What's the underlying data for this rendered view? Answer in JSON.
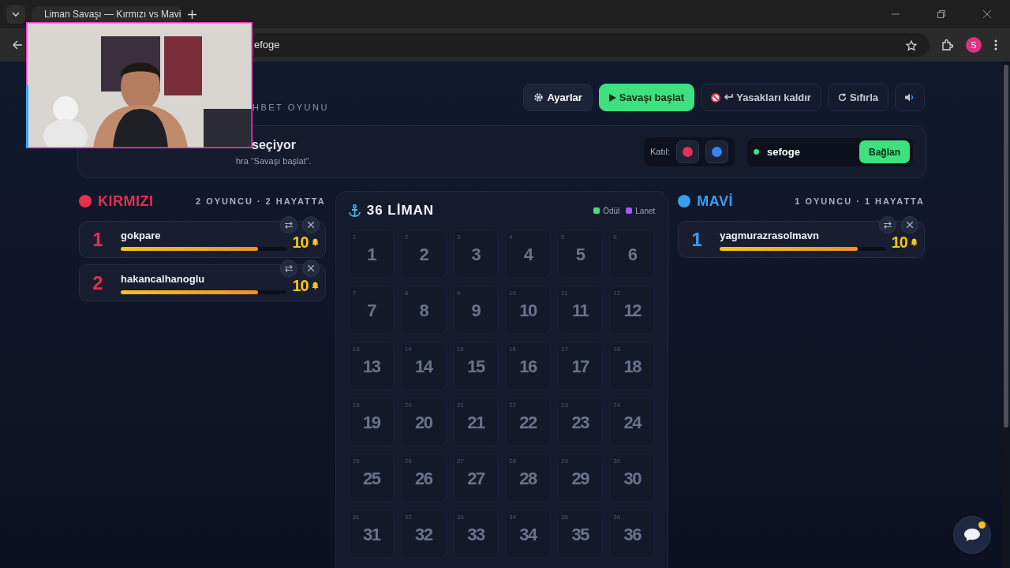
{
  "browser": {
    "tab_title": "Liman Savaşı — Kırmızı vs Mavi",
    "address": "efoge",
    "profile_initial": "S"
  },
  "header": {
    "subtitle": "HBET OYUNU",
    "buttons": [
      {
        "kind": "settings",
        "label": "Ayarlar"
      },
      {
        "kind": "start",
        "label": "Savaşı başlat"
      },
      {
        "kind": "unban",
        "label": "Yasakları kaldır"
      },
      {
        "kind": "reset",
        "label": "Sıfırla"
      },
      {
        "kind": "sound"
      }
    ]
  },
  "info": {
    "title": "seçiyor",
    "hint": "hra “Savaşı başlat”.",
    "join_label": "Katıl:",
    "join_options": [
      {
        "color": "#e5304f"
      },
      {
        "color": "#3b82f6"
      }
    ],
    "channel": {
      "value": "sefoge",
      "online": true
    },
    "connect_button": "Bağlan"
  },
  "teams": [
    {
      "name": "KIRMIZI",
      "color": "#e5304f",
      "summary": "2 OYUNCU · 2 HAYATTA",
      "players": [
        {
          "rank": "1",
          "name": "gokpare",
          "level": 0.83,
          "lives": "10"
        },
        {
          "rank": "2",
          "name": "hakancalhanoglu",
          "level": 0.83,
          "lives": "10"
        }
      ]
    },
    {
      "name": "MAVİ",
      "color": "#3b9cf0",
      "summary": "1 OYUNCU · 1 HAYATTA",
      "players": [
        {
          "rank": "1",
          "name": "yagmurazrasolmavn",
          "level": 0.83,
          "lives": "10"
        }
      ]
    }
  ],
  "board": {
    "title": "36 LİMAN",
    "legend": [
      {
        "label": "Ödül",
        "color": "#3ee07f"
      },
      {
        "label": "Lanet",
        "color": "#a855f7"
      }
    ],
    "ports": [
      {
        "number": "1",
        "label": "1"
      },
      {
        "number": "2",
        "label": "2"
      },
      {
        "number": "3",
        "label": "3"
      },
      {
        "number": "4",
        "label": "4"
      },
      {
        "number": "5",
        "label": "5"
      },
      {
        "number": "6",
        "label": "6"
      },
      {
        "number": "7",
        "label": "7"
      },
      {
        "number": "8",
        "label": "8"
      },
      {
        "number": "9",
        "label": "9"
      },
      {
        "number": "10",
        "label": "10"
      },
      {
        "number": "11",
        "label": "11"
      },
      {
        "number": "12",
        "label": "12"
      },
      {
        "number": "13",
        "label": "13"
      },
      {
        "number": "14",
        "label": "14"
      },
      {
        "number": "15",
        "label": "15"
      },
      {
        "number": "16",
        "label": "16"
      },
      {
        "number": "17",
        "label": "17"
      },
      {
        "number": "18",
        "label": "18"
      },
      {
        "number": "19",
        "label": "19"
      },
      {
        "number": "20",
        "label": "20"
      },
      {
        "number": "21",
        "label": "21"
      },
      {
        "number": "22",
        "label": "22"
      },
      {
        "number": "23",
        "label": "23"
      },
      {
        "number": "24",
        "label": "24"
      },
      {
        "number": "25",
        "label": "25"
      },
      {
        "number": "26",
        "label": "26"
      },
      {
        "number": "27",
        "label": "27"
      },
      {
        "number": "28",
        "label": "28"
      },
      {
        "number": "29",
        "label": "29"
      },
      {
        "number": "30",
        "label": "30"
      },
      {
        "number": "31",
        "label": "31"
      },
      {
        "number": "32",
        "label": "32"
      },
      {
        "number": "33",
        "label": "33"
      },
      {
        "number": "34",
        "label": "34"
      },
      {
        "number": "35",
        "label": "35"
      },
      {
        "number": "36",
        "label": "36"
      }
    ]
  }
}
